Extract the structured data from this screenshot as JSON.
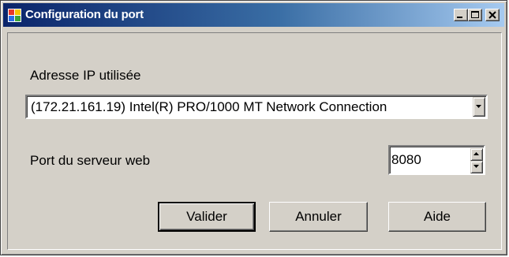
{
  "window": {
    "title": "Configuration du port",
    "colors": {
      "face": "#d4d0c8",
      "titlebar_start": "#0a246a",
      "titlebar_end": "#a6caf0",
      "title_text": "#ffffff"
    },
    "controls": [
      "minimize-icon",
      "maximize-icon",
      "close-icon"
    ],
    "app_icon": "app-icon"
  },
  "form": {
    "ip_label": "Adresse IP utilisée",
    "ip_selected": "(172.21.161.19) Intel(R) PRO/1000 MT Network Connection",
    "port_label": "Port du serveur web",
    "port_value": "8080"
  },
  "buttons": {
    "ok": "Valider",
    "cancel": "Annuler",
    "help": "Aide"
  }
}
